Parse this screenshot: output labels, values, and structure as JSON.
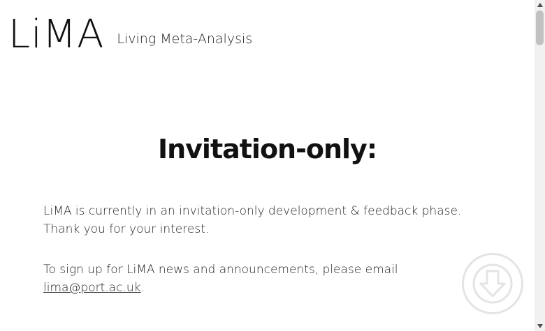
{
  "header": {
    "logo": "LiMA",
    "tagline": "Living Meta-Analysis"
  },
  "main": {
    "headline": "Invitation-only:",
    "paragraph1_line1": "LiMA is currently in an invitation-only development & feedback phase.",
    "paragraph1_line2": "Thank you for your interest.",
    "paragraph2_text": "To sign up for LiMA news and announcements, please email",
    "email_link": "lima@port.ac.uk",
    "paragraph2_end": "."
  },
  "scroll_down_button": {
    "icon": "arrow-down-icon"
  },
  "colors": {
    "text": "#222222",
    "button_border": "#e4e4e4",
    "scrollbar_track": "#f1f1f1",
    "scrollbar_thumb": "#c1c1c1"
  }
}
